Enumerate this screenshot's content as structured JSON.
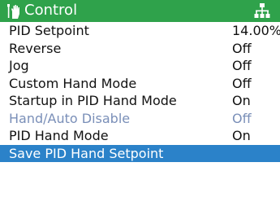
{
  "header": {
    "title": "Control",
    "icon": "hand-wrench-icon",
    "right_icon": "network-icon",
    "background_color": "#2fa24b"
  },
  "menu": {
    "selected_color": "#2b82c9",
    "disabled_color": "#7a8fb8",
    "items": [
      {
        "label": "PID Setpoint",
        "value": "14.00%"
      },
      {
        "label": "Reverse",
        "value": "Off"
      },
      {
        "label": "Jog",
        "value": "Off"
      },
      {
        "label": "Custom Hand Mode",
        "value": "Off"
      },
      {
        "label": "Startup in PID Hand Mode",
        "value": "On"
      },
      {
        "label": "Hand/Auto Disable",
        "value": "Off",
        "disabled": true
      },
      {
        "label": "PID Hand Mode",
        "value": "On"
      },
      {
        "label": "Save PID Hand Setpoint",
        "value": "",
        "selected": true
      }
    ]
  }
}
